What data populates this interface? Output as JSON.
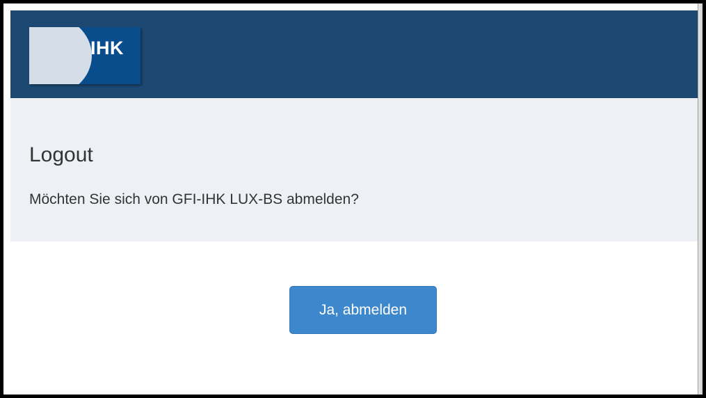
{
  "header": {
    "logo_text": "IHK",
    "brand_color": "#1c4872"
  },
  "main": {
    "title": "Logout",
    "question": "Möchten Sie sich von GFI-IHK LUX-BS abmelden?",
    "band_color": "#edf0f5"
  },
  "actions": {
    "logout_label": "Ja, abmelden",
    "button_color": "#3d87cc"
  }
}
